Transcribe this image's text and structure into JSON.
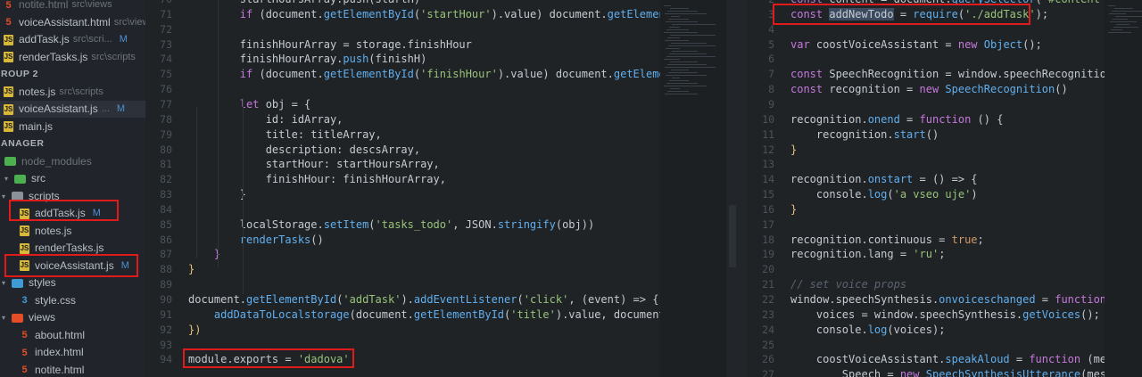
{
  "sidebar": {
    "open_editors": [
      {
        "name": "notite.html",
        "path": "src\\views",
        "icon": "html",
        "faded": true
      },
      {
        "name": "voiceAssistant.html",
        "path": "src\\views",
        "icon": "html"
      },
      {
        "name": "addTask.js",
        "path": "src\\scri...",
        "icon": "js",
        "mod": "M"
      },
      {
        "name": "renderTasks.js",
        "path": "src\\scripts",
        "icon": "js"
      }
    ],
    "group2_label": "ROUP 2",
    "group2": [
      {
        "name": "notes.js",
        "path": "src\\scripts",
        "icon": "js"
      },
      {
        "name": "voiceAssistant.js",
        "path": "...",
        "icon": "js",
        "mod": "M",
        "selected": true
      },
      {
        "name": "main.js",
        "path": "",
        "icon": "js"
      }
    ],
    "explorer_label": "ANAGER",
    "tree": [
      {
        "name": "node_modules",
        "icon": "folder",
        "color": "#4caf50",
        "depth": 0,
        "faded": true
      },
      {
        "name": "src",
        "icon": "folder",
        "color": "#4caf50",
        "depth": 0,
        "chev": "▾"
      },
      {
        "name": "scripts",
        "icon": "folder",
        "color": "#8a9199",
        "depth": 1,
        "chev": "▾"
      },
      {
        "name": "addTask.js",
        "icon": "js",
        "depth": 2,
        "mod": "M",
        "boxed": true
      },
      {
        "name": "notes.js",
        "icon": "js",
        "depth": 2
      },
      {
        "name": "renderTasks.js",
        "icon": "js",
        "depth": 2
      },
      {
        "name": "voiceAssistant.js",
        "icon": "js",
        "depth": 2,
        "mod": "M",
        "boxed": true
      },
      {
        "name": "styles",
        "icon": "folder",
        "color": "#3f9bd6",
        "depth": 1,
        "chev": "▾"
      },
      {
        "name": "style.css",
        "icon": "css",
        "depth": 2
      },
      {
        "name": "views",
        "icon": "folder",
        "color": "#e44d26",
        "depth": 1,
        "chev": "▾"
      },
      {
        "name": "about.html",
        "icon": "html",
        "depth": 2
      },
      {
        "name": "index.html",
        "icon": "html",
        "depth": 2
      },
      {
        "name": "notite.html",
        "icon": "html",
        "depth": 2
      }
    ]
  },
  "left_editor": {
    "lines": [
      {
        "n": "70",
        "t": [
          [
            "plain",
            "        startHoursArray.push(startH)"
          ]
        ]
      },
      {
        "n": "71",
        "t": [
          [
            "kw",
            "        if"
          ],
          [
            "plain",
            " (document."
          ],
          [
            "fn",
            "getElementById"
          ],
          [
            "plain",
            "("
          ],
          [
            "str",
            "'startHour'"
          ],
          [
            "plain",
            ").value) document."
          ],
          [
            "fn",
            "getElementBy"
          ]
        ]
      },
      {
        "n": "72",
        "t": []
      },
      {
        "n": "73",
        "t": [
          [
            "plain",
            "        finishHourArray = storage.finishHour"
          ]
        ]
      },
      {
        "n": "74",
        "t": [
          [
            "plain",
            "        finishHourArray."
          ],
          [
            "fn",
            "push"
          ],
          [
            "plain",
            "(finishH)"
          ]
        ]
      },
      {
        "n": "75",
        "t": [
          [
            "kw",
            "        if"
          ],
          [
            "plain",
            " (document."
          ],
          [
            "fn",
            "getElementById"
          ],
          [
            "plain",
            "("
          ],
          [
            "str",
            "'finishHour'"
          ],
          [
            "plain",
            ").value) document."
          ],
          [
            "fn",
            "getElementBy"
          ]
        ]
      },
      {
        "n": "76",
        "t": []
      },
      {
        "n": "77",
        "t": [
          [
            "kw",
            "        let"
          ],
          [
            "plain",
            " obj = {"
          ]
        ]
      },
      {
        "n": "78",
        "t": [
          [
            "plain",
            "            id: idArray,"
          ]
        ]
      },
      {
        "n": "79",
        "t": [
          [
            "plain",
            "            title: titleArray,"
          ]
        ]
      },
      {
        "n": "80",
        "t": [
          [
            "plain",
            "            description: descsArray,"
          ]
        ]
      },
      {
        "n": "81",
        "t": [
          [
            "plain",
            "            startHour: startHoursArray,"
          ]
        ]
      },
      {
        "n": "82",
        "t": [
          [
            "plain",
            "            finishHour: finishHourArray,"
          ]
        ]
      },
      {
        "n": "83",
        "t": [
          [
            "plain",
            "        }"
          ]
        ]
      },
      {
        "n": "84",
        "t": []
      },
      {
        "n": "85",
        "t": [
          [
            "plain",
            "        localStorage."
          ],
          [
            "fn",
            "setItem"
          ],
          [
            "plain",
            "("
          ],
          [
            "str",
            "'tasks_todo'"
          ],
          [
            "plain",
            ", JSON."
          ],
          [
            "fn",
            "stringify"
          ],
          [
            "plain",
            "(obj))"
          ]
        ]
      },
      {
        "n": "86",
        "t": [
          [
            "fn",
            "        renderTasks"
          ],
          [
            "plain",
            "()"
          ]
        ]
      },
      {
        "n": "87",
        "t": [
          [
            "kw",
            "    }"
          ]
        ]
      },
      {
        "n": "88",
        "t": [
          [
            "yel",
            "}"
          ]
        ]
      },
      {
        "n": "89",
        "t": []
      },
      {
        "n": "90",
        "t": [
          [
            "plain",
            "document."
          ],
          [
            "fn",
            "getElementById"
          ],
          [
            "plain",
            "("
          ],
          [
            "str",
            "'addTask'"
          ],
          [
            "plain",
            ")."
          ],
          [
            "fn",
            "addEventListener"
          ],
          [
            "plain",
            "("
          ],
          [
            "str",
            "'click'"
          ],
          [
            "plain",
            ", (event) => {"
          ]
        ]
      },
      {
        "n": "91",
        "t": [
          [
            "fn",
            "    addDataToLocalstorage"
          ],
          [
            "plain",
            "(document."
          ],
          [
            "fn",
            "getElementById"
          ],
          [
            "plain",
            "("
          ],
          [
            "str",
            "'title'"
          ],
          [
            "plain",
            ").value, document.ge"
          ]
        ]
      },
      {
        "n": "92",
        "t": [
          [
            "yel",
            "})"
          ]
        ]
      },
      {
        "n": "93",
        "t": []
      },
      {
        "n": "94",
        "t": [
          [
            "plain",
            "module.exports = "
          ],
          [
            "str",
            "'dadova'"
          ]
        ]
      }
    ]
  },
  "right_editor": {
    "lines": [
      {
        "n": "2",
        "t": [
          [
            "kw",
            "const"
          ],
          [
            "plain",
            " content = document."
          ],
          [
            "fn",
            "querySelector"
          ],
          [
            "plain",
            "("
          ],
          [
            "str",
            "'#content'"
          ],
          [
            "plain",
            ")"
          ]
        ]
      },
      {
        "n": "3",
        "t": [
          [
            "kw",
            "const"
          ],
          [
            "plain",
            " "
          ],
          [
            "sel",
            "addNewTodo"
          ],
          [
            "plain",
            " = "
          ],
          [
            "fn",
            "require"
          ],
          [
            "plain",
            "("
          ],
          [
            "str",
            "'./addTask'"
          ],
          [
            "plain",
            ");"
          ]
        ]
      },
      {
        "n": "4",
        "t": []
      },
      {
        "n": "5",
        "t": [
          [
            "kw",
            "var"
          ],
          [
            "plain",
            " coostVoiceAssistant = "
          ],
          [
            "kw",
            "new"
          ],
          [
            "plain",
            " "
          ],
          [
            "fn",
            "Object"
          ],
          [
            "plain",
            "();"
          ]
        ]
      },
      {
        "n": "6",
        "t": []
      },
      {
        "n": "7",
        "t": [
          [
            "kw",
            "const"
          ],
          [
            "plain",
            " SpeechRecognition = window.speechRecognition ||"
          ]
        ]
      },
      {
        "n": "8",
        "t": [
          [
            "kw",
            "const"
          ],
          [
            "plain",
            " recognition = "
          ],
          [
            "kw",
            "new"
          ],
          [
            "plain",
            " "
          ],
          [
            "fn",
            "SpeechRecognition"
          ],
          [
            "plain",
            "()"
          ]
        ]
      },
      {
        "n": "9",
        "t": []
      },
      {
        "n": "10",
        "t": [
          [
            "plain",
            "recognition."
          ],
          [
            "fn",
            "onend"
          ],
          [
            "plain",
            " = "
          ],
          [
            "kw",
            "function"
          ],
          [
            "plain",
            " () {"
          ]
        ]
      },
      {
        "n": "11",
        "t": [
          [
            "plain",
            "    recognition."
          ],
          [
            "fn",
            "start"
          ],
          [
            "plain",
            "()"
          ]
        ]
      },
      {
        "n": "12",
        "t": [
          [
            "yel",
            "}"
          ]
        ]
      },
      {
        "n": "13",
        "t": []
      },
      {
        "n": "14",
        "t": [
          [
            "plain",
            "recognition."
          ],
          [
            "fn",
            "onstart"
          ],
          [
            "plain",
            " = () => {"
          ]
        ]
      },
      {
        "n": "15",
        "t": [
          [
            "plain",
            "    console."
          ],
          [
            "fn",
            "log"
          ],
          [
            "plain",
            "("
          ],
          [
            "str",
            "'a vseo uje'"
          ],
          [
            "plain",
            ")"
          ]
        ]
      },
      {
        "n": "16",
        "t": [
          [
            "yel",
            "}"
          ]
        ]
      },
      {
        "n": "17",
        "t": []
      },
      {
        "n": "18",
        "t": [
          [
            "plain",
            "recognition.continuous = "
          ],
          [
            "bool",
            "true"
          ],
          [
            "plain",
            ";"
          ]
        ]
      },
      {
        "n": "19",
        "t": [
          [
            "plain",
            "recognition.lang = "
          ],
          [
            "str",
            "'ru'"
          ],
          [
            "plain",
            ";"
          ]
        ]
      },
      {
        "n": "20",
        "t": []
      },
      {
        "n": "21",
        "t": [
          [
            "cmt",
            "// set voice props"
          ]
        ]
      },
      {
        "n": "22",
        "t": [
          [
            "plain",
            "window.speechSynthesis."
          ],
          [
            "fn",
            "onvoiceschanged"
          ],
          [
            "plain",
            " = "
          ],
          [
            "kw",
            "function"
          ],
          [
            "plain",
            " () {"
          ]
        ]
      },
      {
        "n": "23",
        "t": [
          [
            "plain",
            "    voices = window.speechSynthesis."
          ],
          [
            "fn",
            "getVoices"
          ],
          [
            "plain",
            "();"
          ]
        ]
      },
      {
        "n": "24",
        "t": [
          [
            "plain",
            "    console."
          ],
          [
            "fn",
            "log"
          ],
          [
            "plain",
            "(voices);"
          ]
        ]
      },
      {
        "n": "25",
        "t": []
      },
      {
        "n": "26",
        "t": [
          [
            "plain",
            "    coostVoiceAssistant."
          ],
          [
            "fn",
            "speakAloud"
          ],
          [
            "plain",
            " = "
          ],
          [
            "kw",
            "function"
          ],
          [
            "plain",
            " (message"
          ]
        ]
      },
      {
        "n": "27",
        "t": [
          [
            "plain",
            "        Speech = "
          ],
          [
            "kw",
            "new"
          ],
          [
            "plain",
            " "
          ],
          [
            "fn",
            "SpeechSynthesisUtterance"
          ],
          [
            "plain",
            "(message"
          ]
        ]
      }
    ]
  }
}
